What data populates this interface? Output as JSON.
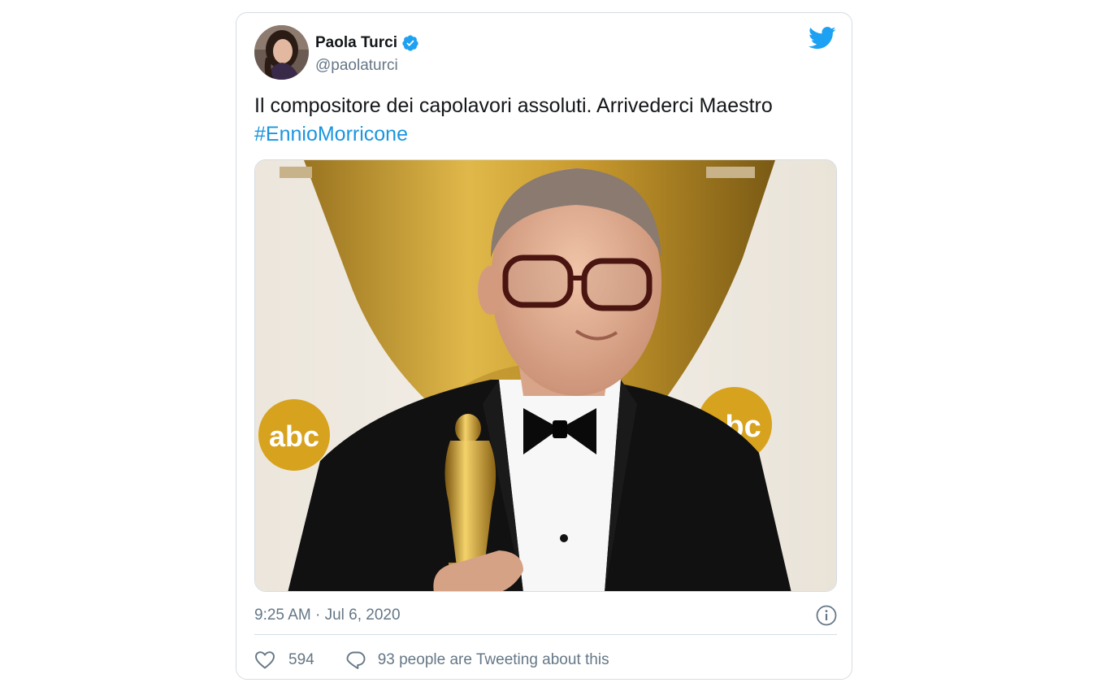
{
  "author": {
    "name": "Paola Turci",
    "handle": "@paolaturci",
    "verified": true
  },
  "tweet": {
    "text": "Il compositore dei capolavori assoluti. Arrivederci Maestro",
    "hashtag": "#EnnioMorricone",
    "timestamp": "9:25 AM · Jul 6, 2020"
  },
  "media": {
    "description_icon": "photo",
    "logo_text": "abc"
  },
  "actions": {
    "likes": "594",
    "conversation": "93 people are Tweeting about this"
  },
  "icons": {
    "brand": "twitter-bird-icon",
    "verified": "verified-badge-icon",
    "info": "info-icon",
    "like": "heart-icon",
    "reply": "speech-bubble-icon"
  },
  "colors": {
    "accent": "#1da1f2",
    "link": "#1b95e0",
    "secondary_text": "#657786",
    "border": "#d6dde3"
  }
}
